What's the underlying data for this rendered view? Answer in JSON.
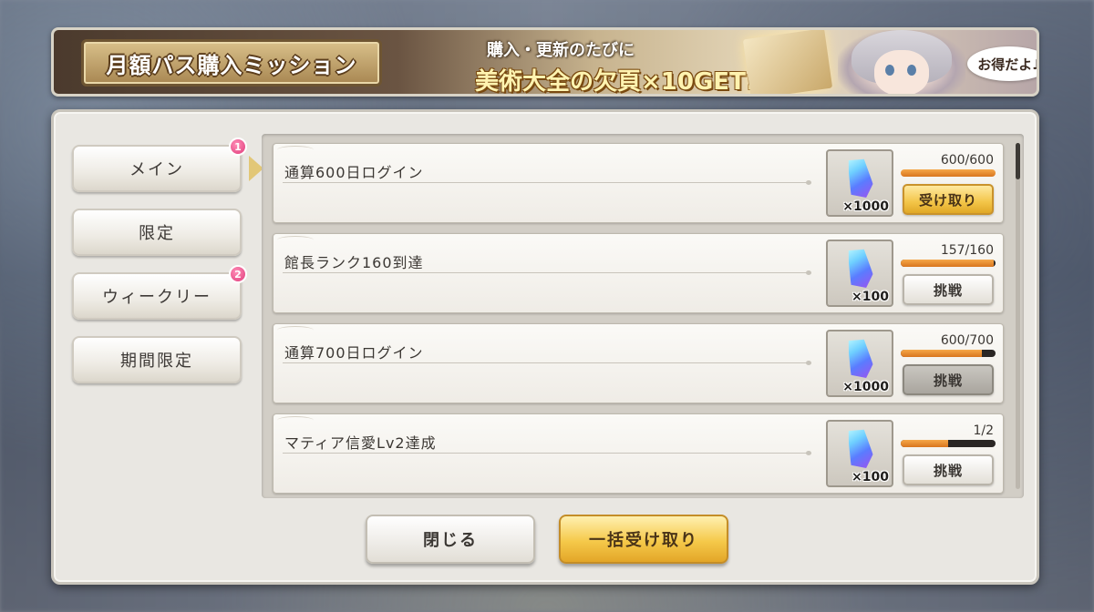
{
  "banner": {
    "title": "月額パス購入ミッション",
    "sub_line1": "購入・更新のたびに",
    "sub_line2": "美術大全の欠頁×10GET!!",
    "bubble": "お得だよ♪"
  },
  "tabs": [
    {
      "label": "メイン",
      "badge": "1",
      "selected": true
    },
    {
      "label": "限定",
      "badge": null
    },
    {
      "label": "ウィークリー",
      "badge": "2"
    },
    {
      "label": "期間限定",
      "badge": null
    }
  ],
  "missions": [
    {
      "title": "通算600日ログイン",
      "reward_icon": "crystal-icon",
      "reward_qty": "×1000",
      "progress_text": "600/600",
      "progress": 1.0,
      "button": "受け取り",
      "button_state": "claim"
    },
    {
      "title": "館長ランク160到達",
      "reward_icon": "crystal-icon",
      "reward_qty": "×100",
      "progress_text": "157/160",
      "progress": 0.98,
      "button": "挑戦",
      "button_state": "normal"
    },
    {
      "title": "通算700日ログイン",
      "reward_icon": "crystal-icon",
      "reward_qty": "×1000",
      "progress_text": "600/700",
      "progress": 0.857,
      "button": "挑戦",
      "button_state": "disabled"
    },
    {
      "title": "マティア信愛Lv2達成",
      "reward_icon": "crystal-icon",
      "reward_qty": "×100",
      "progress_text": "1/2",
      "progress": 0.5,
      "button": "挑戦",
      "button_state": "normal"
    }
  ],
  "footer": {
    "close_label": "閉じる",
    "claim_all_label": "一括受け取り"
  }
}
